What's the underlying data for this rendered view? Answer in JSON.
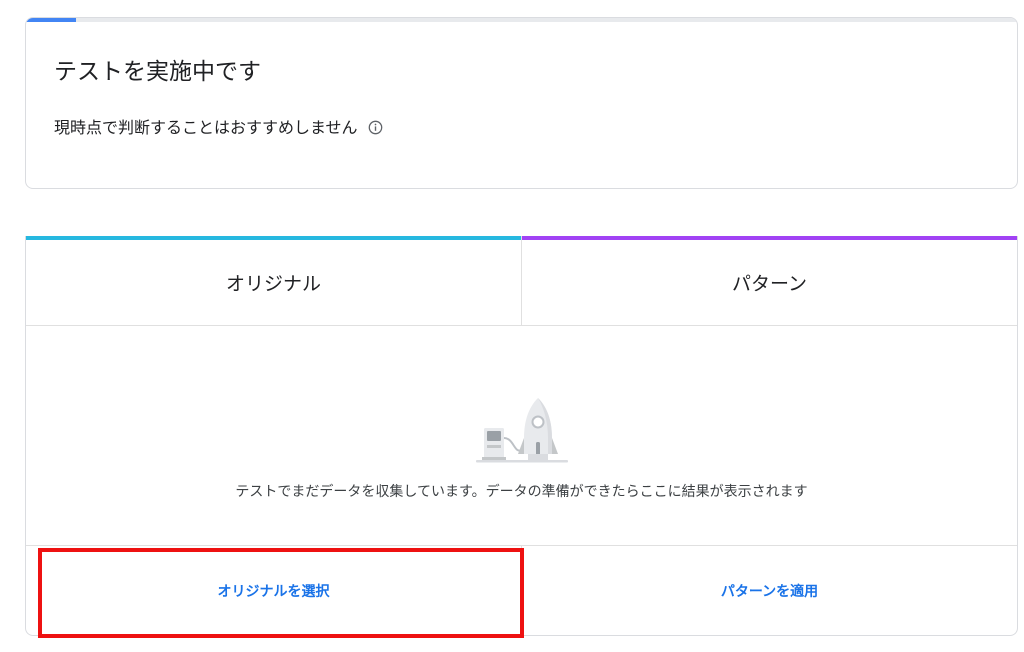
{
  "status": {
    "title": "テストを実施中です",
    "subtitle": "現時点で判断することはおすすめしません",
    "progress_percent": 5,
    "progress_color": "#4285f4",
    "info_icon": "info-icon"
  },
  "comparison": {
    "variants": [
      {
        "label": "オリジナル",
        "color": "#26b8e0"
      },
      {
        "label": "パターン",
        "color": "#a142f4"
      }
    ],
    "empty_state": {
      "illustration": "rocket-fuel-pump-illustration",
      "message": "テストでまだデータを収集しています。データの準備ができたらここに結果が表示されます"
    },
    "actions": {
      "select_original": "オリジナルを選択",
      "apply_pattern": "パターンを適用",
      "color": "#1a73e8"
    }
  },
  "highlight": {
    "color": "#ee1111",
    "target": "select-original-button"
  }
}
